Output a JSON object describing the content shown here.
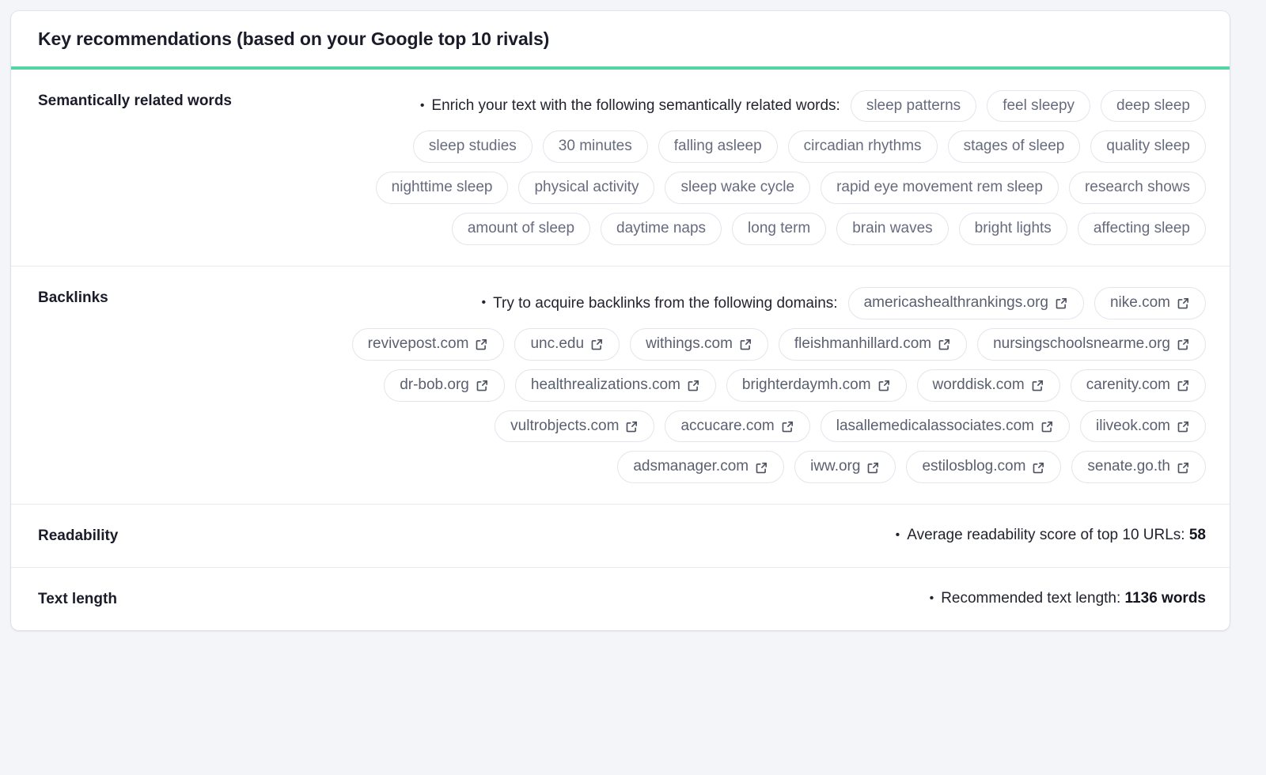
{
  "header": {
    "title": "Key recommendations (based on your Google top 10 rivals)",
    "accent_color": "#54d6a4"
  },
  "sections": {
    "semantic": {
      "label": "Semantically related words",
      "bullet_text": "Enrich your text with the following semantically related words:",
      "chips": [
        "sleep patterns",
        "feel sleepy",
        "deep sleep",
        "sleep studies",
        "30 minutes",
        "falling asleep",
        "circadian rhythms",
        "stages of sleep",
        "quality sleep",
        "nighttime sleep",
        "physical activity",
        "sleep wake cycle",
        "rapid eye movement rem sleep",
        "research shows",
        "amount of sleep",
        "daytime naps",
        "long term",
        "brain waves",
        "bright lights",
        "affecting sleep"
      ]
    },
    "backlinks": {
      "label": "Backlinks",
      "bullet_text": "Try to acquire backlinks from the following domains:",
      "icon": "external-link-icon",
      "chips": [
        "americashealthrankings.org",
        "nike.com",
        "revivepost.com",
        "unc.edu",
        "withings.com",
        "fleishmanhillard.com",
        "nursingschoolsnearme.org",
        "dr-bob.org",
        "healthrealizations.com",
        "brighterdaymh.com",
        "worddisk.com",
        "carenity.com",
        "vultrobjects.com",
        "accucare.com",
        "lasallemedicalassociates.com",
        "iliveok.com",
        "adsmanager.com",
        "iww.org",
        "estilosblog.com",
        "senate.go.th"
      ]
    },
    "readability": {
      "label": "Readability",
      "bullet_prefix": "Average readability score of top 10 URLs:",
      "value": "58"
    },
    "text_length": {
      "label": "Text length",
      "bullet_prefix": "Recommended text length:",
      "value": "1136 words"
    }
  }
}
